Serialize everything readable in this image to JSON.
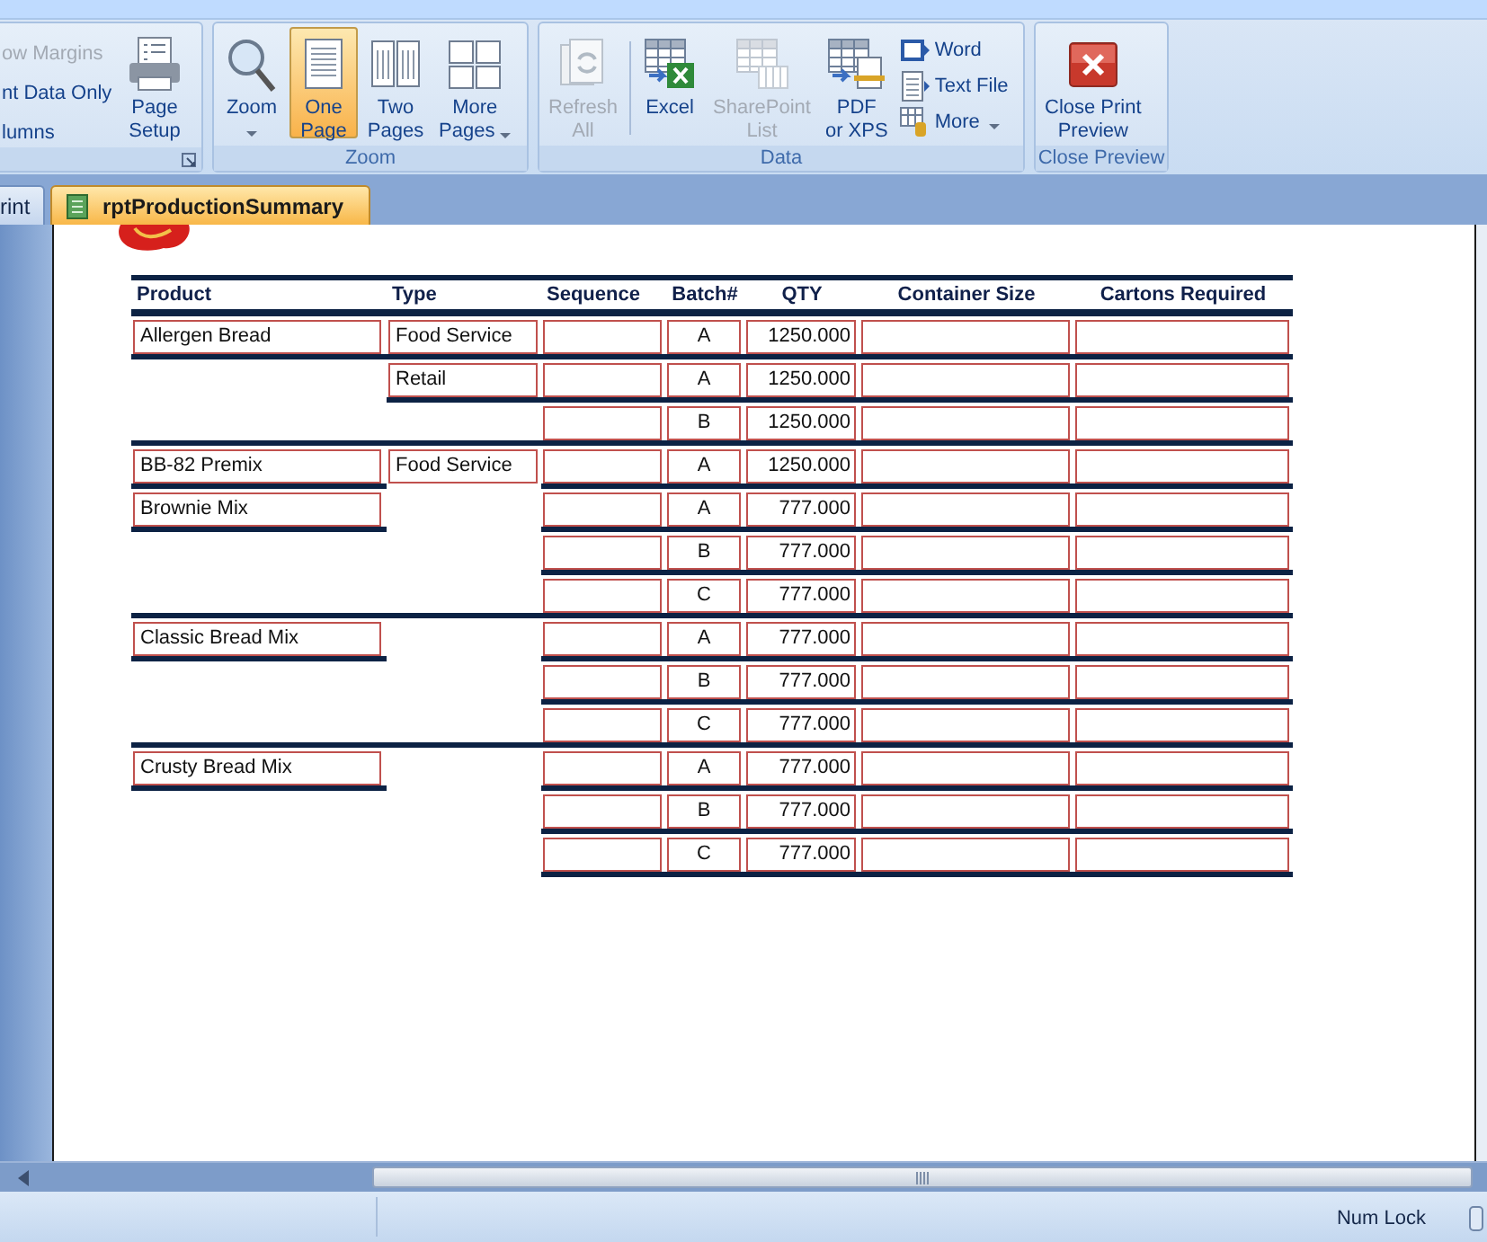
{
  "ribbon": {
    "groups": [
      {
        "dialog_launcher": true,
        "items": [
          {
            "kind": "small",
            "label": "ow Margins",
            "disabled": true
          },
          {
            "kind": "small",
            "label": "nt Data Only",
            "disabled": false
          },
          {
            "kind": "small",
            "label": "lumns",
            "disabled": false
          },
          {
            "kind": "large",
            "label": "Page\nSetup",
            "disabled": false
          }
        ]
      },
      {
        "label": "Zoom",
        "dialog_launcher": false,
        "items": [
          {
            "kind": "large",
            "label": "Zoom",
            "disabled": false,
            "selected": false,
            "dropdown": true
          },
          {
            "kind": "large",
            "label": "One\nPage",
            "disabled": false,
            "selected": true,
            "dropdown": false
          },
          {
            "kind": "large",
            "label": "Two\nPages",
            "disabled": false,
            "selected": false,
            "dropdown": false
          },
          {
            "kind": "large",
            "label": "More\nPages",
            "disabled": false,
            "selected": false,
            "dropdown": true
          }
        ]
      },
      {
        "label": "Data",
        "dialog_launcher": false,
        "items": [
          {
            "kind": "large",
            "label": "Refresh\nAll",
            "disabled": true
          },
          {
            "kind": "separator"
          },
          {
            "kind": "large",
            "label": "Excel",
            "disabled": false
          },
          {
            "kind": "large",
            "label": "SharePoint\nList",
            "disabled": true
          },
          {
            "kind": "large",
            "label": "PDF\nor XPS",
            "disabled": false
          },
          {
            "kind": "small",
            "label": "Word",
            "disabled": false
          },
          {
            "kind": "small",
            "label": "Text File",
            "disabled": false
          },
          {
            "kind": "small",
            "label": "More",
            "disabled": false,
            "dropdown": true
          }
        ]
      },
      {
        "label": "Close Preview",
        "dialog_launcher": false,
        "items": [
          {
            "kind": "large",
            "label": "Close Print\nPreview",
            "disabled": false
          }
        ]
      }
    ]
  },
  "document_tabs": [
    {
      "label": "rint",
      "selected": false
    },
    {
      "label": "rptProductionSummary",
      "selected": true
    }
  ],
  "report": {
    "columns": [
      "Product",
      "Type",
      "Sequence",
      "Batch#",
      "QTY",
      "Container Size",
      "Cartons Required"
    ],
    "rows": [
      {
        "product": "Allergen Bread",
        "type": "Food Service",
        "batch": "A",
        "qty": "1250.000"
      },
      {
        "type": "Retail",
        "batch": "A",
        "qty": "1250.000"
      },
      {
        "batch": "B",
        "qty": "1250.000"
      },
      {
        "product": "BB-82 Premix",
        "type": "Food Service",
        "batch": "A",
        "qty": "1250.000"
      },
      {
        "product": "Brownie Mix",
        "batch": "A",
        "qty": "777.000"
      },
      {
        "batch": "B",
        "qty": "777.000"
      },
      {
        "batch": "C",
        "qty": "777.000"
      },
      {
        "product": "Classic Bread Mix",
        "batch": "A",
        "qty": "777.000"
      },
      {
        "batch": "B",
        "qty": "777.000"
      },
      {
        "batch": "C",
        "qty": "777.000"
      },
      {
        "product": "Crusty Bread Mix",
        "batch": "A",
        "qty": "777.000"
      },
      {
        "batch": "B",
        "qty": "777.000"
      },
      {
        "batch": "C",
        "qty": "777.000"
      }
    ]
  },
  "status_bar": {
    "text": "Num Lock"
  }
}
